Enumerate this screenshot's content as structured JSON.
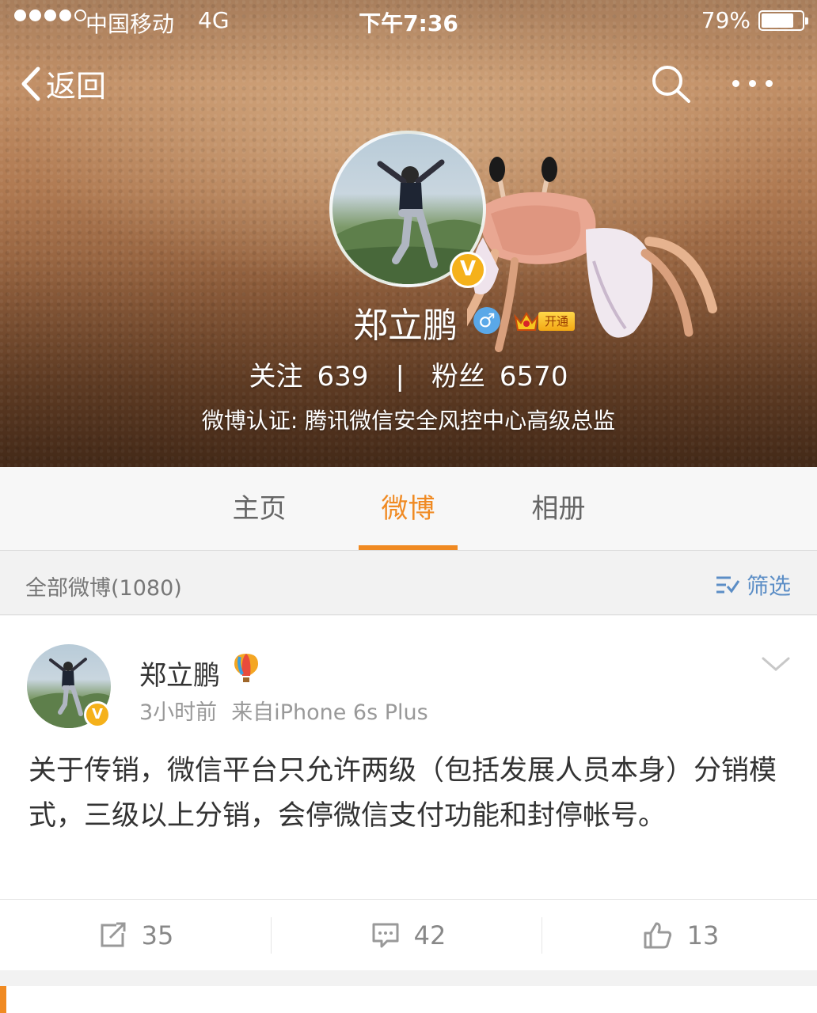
{
  "status_bar": {
    "carrier": "中国移动",
    "network": "4G",
    "time": "下午7:36",
    "battery": "79%",
    "battery_level": 0.79
  },
  "nav": {
    "back_label": "返回"
  },
  "profile": {
    "name": "郑立鹏",
    "vip_label": "开通",
    "following_label": "关注",
    "following_count": "639",
    "separator": "|",
    "followers_label": "粉丝",
    "followers_count": "6570",
    "verification": "微博认证: 腾讯微信安全风控中心高级总监"
  },
  "tabs": [
    {
      "label": "主页"
    },
    {
      "label": "微博"
    },
    {
      "label": "相册"
    }
  ],
  "active_tab": "微博",
  "filter_bar": {
    "count_text": "全部微博(1080)",
    "filter_label": "筛选"
  },
  "post": {
    "author": "郑立鹏",
    "time": "3小时前",
    "source": "来自iPhone 6s Plus",
    "text": "关于传销，微信平台只允许两级（包括发展人员本身）分销模式，三级以上分销，会停微信支付功能和封停帐号。",
    "actions": {
      "repost_count": "35",
      "comment_count": "42",
      "like_count": "13"
    }
  },
  "colors": {
    "accent": "#f08a22",
    "link": "#5c8ec6",
    "verified": "#f5b11a"
  },
  "icons": [
    "back-chevron-icon",
    "search-icon",
    "more-icon",
    "verified-icon",
    "male-icon",
    "vip-crown-icon",
    "filter-icon",
    "balloon-icon",
    "chevron-down-icon",
    "repost-icon",
    "comment-icon",
    "like-icon"
  ]
}
